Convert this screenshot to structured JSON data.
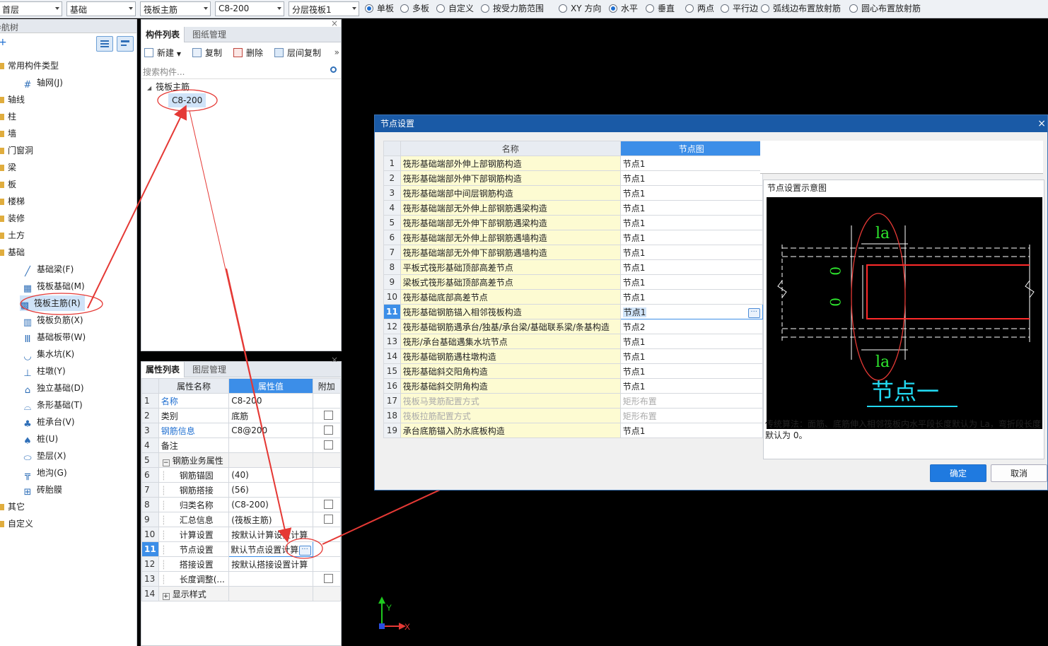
{
  "toolbar": {
    "floor": "首层",
    "category": "基础",
    "component_type": "筏板主筋",
    "component": "C8-200",
    "layer": "分层筏板1",
    "radios": [
      {
        "label": "单板",
        "checked": true
      },
      {
        "label": "多板",
        "checked": false
      },
      {
        "label": "自定义",
        "checked": false
      },
      {
        "label": "按受力筋范围",
        "checked": false
      },
      {
        "label": "XY 方向",
        "checked": false
      },
      {
        "label": "水平",
        "checked": true
      },
      {
        "label": "垂直",
        "checked": false
      },
      {
        "label": "两点",
        "checked": false
      },
      {
        "label": "平行边",
        "checked": false
      },
      {
        "label": "弧线边布置放射筋",
        "checked": false
      },
      {
        "label": "圆心布置放射筋",
        "checked": false
      }
    ]
  },
  "nav": {
    "title": "导航树",
    "plus": "+",
    "items": [
      {
        "label": "常用构件类型",
        "kind": "folder"
      },
      {
        "label": "轴网(J)",
        "kind": "child",
        "icon": "#"
      },
      {
        "label": "轴线",
        "kind": "folder"
      },
      {
        "label": "柱",
        "kind": "folder"
      },
      {
        "label": "墙",
        "kind": "folder"
      },
      {
        "label": "门窗洞",
        "kind": "folder"
      },
      {
        "label": "梁",
        "kind": "folder"
      },
      {
        "label": "板",
        "kind": "folder"
      },
      {
        "label": "楼梯",
        "kind": "folder"
      },
      {
        "label": "装修",
        "kind": "folder"
      },
      {
        "label": "土方",
        "kind": "folder"
      },
      {
        "label": "基础",
        "kind": "folder"
      },
      {
        "label": "基础梁(F)",
        "kind": "child",
        "icon": "╱"
      },
      {
        "label": "筏板基础(M)",
        "kind": "child",
        "icon": "▦"
      },
      {
        "label": "筏板主筋(R)",
        "kind": "child",
        "icon": "▩"
      },
      {
        "label": "筏板负筋(X)",
        "kind": "child",
        "icon": "▥"
      },
      {
        "label": "基础板带(W)",
        "kind": "child",
        "icon": "Ⅲ"
      },
      {
        "label": "集水坑(K)",
        "kind": "child",
        "icon": "◡"
      },
      {
        "label": "柱墩(Y)",
        "kind": "child",
        "icon": "⊥"
      },
      {
        "label": "独立基础(D)",
        "kind": "child",
        "icon": "⌂"
      },
      {
        "label": "条形基础(T)",
        "kind": "child",
        "icon": "⌓"
      },
      {
        "label": "桩承台(V)",
        "kind": "child",
        "icon": "♣"
      },
      {
        "label": "桩(U)",
        "kind": "child",
        "icon": "♠"
      },
      {
        "label": "垫层(X)",
        "kind": "child",
        "icon": "⬭"
      },
      {
        "label": "地沟(G)",
        "kind": "child",
        "icon": "╦"
      },
      {
        "label": "砖胎膜",
        "kind": "child",
        "icon": "⊞"
      },
      {
        "label": "其它",
        "kind": "folder"
      },
      {
        "label": "自定义",
        "kind": "folder"
      }
    ]
  },
  "comp_panel": {
    "tabs": [
      "构件列表",
      "图纸管理"
    ],
    "buttons": [
      "新建",
      "复制",
      "删除",
      "层间复制"
    ],
    "more": "»",
    "close": "×",
    "search_placeholder": "搜索构件...",
    "tree_parent": "筏板主筋",
    "tree_child": "C8-200"
  },
  "prop_panel": {
    "tabs": [
      "属性列表",
      "图层管理"
    ],
    "close": "×",
    "headers": [
      "属性名称",
      "属性值",
      "附加"
    ],
    "rows": [
      {
        "n": "1",
        "name": "名称",
        "value": "C8-200",
        "cb": false,
        "blue": true
      },
      {
        "n": "2",
        "name": "类别",
        "value": "底筋",
        "cb": true
      },
      {
        "n": "3",
        "name": "钢筋信息",
        "value": "C8@200",
        "cb": true,
        "blue": true
      },
      {
        "n": "4",
        "name": "备注",
        "value": "",
        "cb": true
      },
      {
        "n": "5",
        "name": "钢筋业务属性",
        "value": "",
        "cb": false,
        "expander": "−",
        "group": true
      },
      {
        "n": "6",
        "name": "钢筋锚固",
        "value": "(40)",
        "cb": false,
        "indent": true
      },
      {
        "n": "7",
        "name": "钢筋搭接",
        "value": "(56)",
        "cb": false,
        "indent": true
      },
      {
        "n": "8",
        "name": "归类名称",
        "value": "(C8-200)",
        "cb": true,
        "indent": true
      },
      {
        "n": "9",
        "name": "汇总信息",
        "value": "(筏板主筋)",
        "cb": true,
        "indent": true
      },
      {
        "n": "10",
        "name": "计算设置",
        "value": "按默认计算设置计算",
        "cb": false,
        "indent": true
      },
      {
        "n": "11",
        "name": "节点设置",
        "value": "默认节点设置计算",
        "cb": false,
        "indent": true,
        "selected": true
      },
      {
        "n": "12",
        "name": "搭接设置",
        "value": "按默认搭接设置计算",
        "cb": false,
        "indent": true
      },
      {
        "n": "13",
        "name": "长度调整(...",
        "value": "",
        "cb": true,
        "indent": true
      },
      {
        "n": "14",
        "name": "显示样式",
        "value": "",
        "cb": false,
        "expander": "+",
        "group": true
      }
    ]
  },
  "dialog": {
    "title": "节点设置",
    "close": "×",
    "headers": [
      "名称",
      "节点图"
    ],
    "rows": [
      {
        "n": "1",
        "name": "筏形基础端部外伸上部钢筋构造",
        "node": "节点1"
      },
      {
        "n": "2",
        "name": "筏形基础端部外伸下部钢筋构造",
        "node": "节点1"
      },
      {
        "n": "3",
        "name": "筏形基础端部中间层钢筋构造",
        "node": "节点1"
      },
      {
        "n": "4",
        "name": "筏形基础端部无外伸上部钢筋遇梁构造",
        "node": "节点1"
      },
      {
        "n": "5",
        "name": "筏形基础端部无外伸下部钢筋遇梁构造",
        "node": "节点1"
      },
      {
        "n": "6",
        "name": "筏形基础端部无外伸上部钢筋遇墙构造",
        "node": "节点1"
      },
      {
        "n": "7",
        "name": "筏形基础端部无外伸下部钢筋遇墙构造",
        "node": "节点1"
      },
      {
        "n": "8",
        "name": "平板式筏形基础顶部高差节点",
        "node": "节点1"
      },
      {
        "n": "9",
        "name": "梁板式筏形基础顶部高差节点",
        "node": "节点1"
      },
      {
        "n": "10",
        "name": "筏形基础底部高差节点",
        "node": "节点1"
      },
      {
        "n": "11",
        "name": "筏形基础钢筋锚入相邻筏板构造",
        "node": "节点1",
        "selected": true
      },
      {
        "n": "12",
        "name": "筏形基础钢筋遇承台/独基/承台梁/基础联系梁/条基构造",
        "node": "节点2"
      },
      {
        "n": "13",
        "name": "筏形/承台基础遇集水坑节点",
        "node": "节点1"
      },
      {
        "n": "14",
        "name": "筏形基础钢筋遇柱墩构造",
        "node": "节点1"
      },
      {
        "n": "15",
        "name": "筏形基础斜交阳角构造",
        "node": "节点1"
      },
      {
        "n": "16",
        "name": "筏形基础斜交阴角构造",
        "node": "节点1"
      },
      {
        "n": "17",
        "name": "筏板马凳筋配置方式",
        "node": "矩形布置",
        "disabled": true
      },
      {
        "n": "18",
        "name": "筏板拉筋配置方式",
        "node": "矩形布置",
        "disabled": true
      },
      {
        "n": "19",
        "name": "承台底筋锚入防水底板构造",
        "node": "节点1"
      }
    ],
    "preview_title": "节点设置示意图",
    "diagram": {
      "la_top": "la",
      "la_bottom": "la",
      "zero_a": "0",
      "zero_b": "0",
      "caption": "节点一"
    },
    "description": "传统算法：面筋、底筋伸入相邻筏板内水平段长度默认为 La，弯折段长度默认为 0。",
    "ok": "确定",
    "cancel": "取消"
  },
  "axis": {
    "x": "X",
    "y": "Y"
  },
  "colors": {
    "accent": "#3c8ee8",
    "annotation": "#e53935",
    "titlebar": "#1a5aa6"
  }
}
